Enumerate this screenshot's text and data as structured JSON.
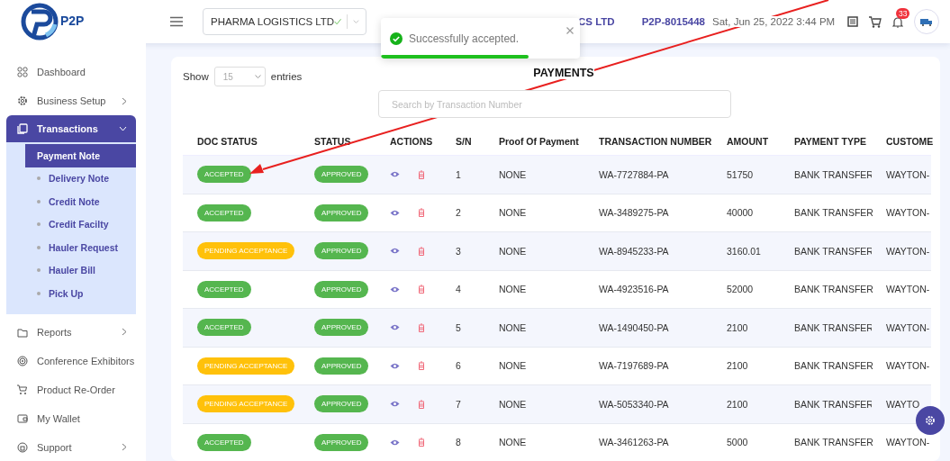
{
  "header": {
    "logo_text": "P2P",
    "company_select": {
      "value": "PHARMA LOGISTICS LTD"
    },
    "company_name": "CS LTD",
    "account_id": "P2P-8015448",
    "datetime": "Sat, Jun 25, 2022 3:44 PM",
    "notification_count": "33"
  },
  "toast": {
    "message": "Successfully accepted.",
    "level": 0.74
  },
  "sidebar": {
    "items": [
      {
        "label": "Dashboard",
        "kind": "link",
        "selected": false
      },
      {
        "label": "Business Setup",
        "kind": "group",
        "expanded": false,
        "selected": false
      },
      {
        "label": "Transactions",
        "kind": "group",
        "expanded": true,
        "selected": true,
        "children": [
          {
            "label": "Payment Note",
            "selected": true
          },
          {
            "label": "Delivery Note",
            "selected": false
          },
          {
            "label": "Credit Note",
            "selected": false
          },
          {
            "label": "Credit Facilty",
            "selected": false
          },
          {
            "label": "Hauler Request",
            "selected": false
          },
          {
            "label": "Hauler Bill",
            "selected": false
          },
          {
            "label": "Pick Up",
            "selected": false
          }
        ]
      },
      {
        "label": "Reports",
        "kind": "group",
        "expanded": false,
        "selected": false
      },
      {
        "label": "Conference Exhibitors",
        "kind": "link",
        "selected": false
      },
      {
        "label": "Product Re-Order",
        "kind": "link",
        "selected": false
      },
      {
        "label": "My Wallet",
        "kind": "link",
        "selected": false
      },
      {
        "label": "Support",
        "kind": "group",
        "expanded": false,
        "selected": false
      }
    ]
  },
  "table": {
    "title": "PAYMENTS",
    "show_label": "Show",
    "entries_value": "15",
    "entries_label": "entries",
    "search": {
      "placeholder": "Search by Transaction Number"
    },
    "columns": [
      "DOC STATUS",
      "STATUS",
      "ACTIONS",
      "S/N",
      "Proof Of Payment",
      "TRANSACTION NUMBER",
      "AMOUNT",
      "PAYMENT TYPE",
      "CUSTOME"
    ],
    "rows": [
      {
        "doc_status": {
          "label": "ACCEPTED",
          "kind": "accepted"
        },
        "status": "APPROVED",
        "sn": "1",
        "proof": "NONE",
        "transaction": "WA-7727884-PA",
        "amount": "51750",
        "payment_type": "BANK TRANSFER",
        "customer": "WAYTON-"
      },
      {
        "doc_status": {
          "label": "ACCEPTED",
          "kind": "accepted"
        },
        "status": "APPROVED",
        "sn": "2",
        "proof": "NONE",
        "transaction": "WA-3489275-PA",
        "amount": "40000",
        "payment_type": "BANK TRANSFER",
        "customer": "WAYTON-"
      },
      {
        "doc_status": {
          "label": "PENDING ACCEPTANCE",
          "kind": "pending"
        },
        "status": "APPROVED",
        "sn": "3",
        "proof": "NONE",
        "transaction": "WA-8945233-PA",
        "amount": "3160.01",
        "payment_type": "BANK TRANSFER",
        "customer": "WAYTON-"
      },
      {
        "doc_status": {
          "label": "ACCEPTED",
          "kind": "accepted"
        },
        "status": "APPROVED",
        "sn": "4",
        "proof": "NONE",
        "transaction": "WA-4923516-PA",
        "amount": "52000",
        "payment_type": "BANK TRANSFER",
        "customer": "WAYTON-"
      },
      {
        "doc_status": {
          "label": "ACCEPTED",
          "kind": "accepted"
        },
        "status": "APPROVED",
        "sn": "5",
        "proof": "NONE",
        "transaction": "WA-1490450-PA",
        "amount": "2100",
        "payment_type": "BANK TRANSFER",
        "customer": "WAYTON-"
      },
      {
        "doc_status": {
          "label": "PENDING ACCEPTANCE",
          "kind": "pending"
        },
        "status": "APPROVED",
        "sn": "6",
        "proof": "NONE",
        "transaction": "WA-7197689-PA",
        "amount": "2100",
        "payment_type": "BANK TRANSFER",
        "customer": "WAYTON-"
      },
      {
        "doc_status": {
          "label": "PENDING ACCEPTANCE",
          "kind": "pending"
        },
        "status": "APPROVED",
        "sn": "7",
        "proof": "NONE",
        "transaction": "WA-5053340-PA",
        "amount": "2100",
        "payment_type": "BANK TRANSFER",
        "customer": "WAYTO"
      },
      {
        "doc_status": {
          "label": "ACCEPTED",
          "kind": "accepted"
        },
        "status": "APPROVED",
        "sn": "8",
        "proof": "NONE",
        "transaction": "WA-3461263-PA",
        "amount": "5000",
        "payment_type": "BANK TRANSFER",
        "customer": "WAYTON-"
      }
    ]
  }
}
